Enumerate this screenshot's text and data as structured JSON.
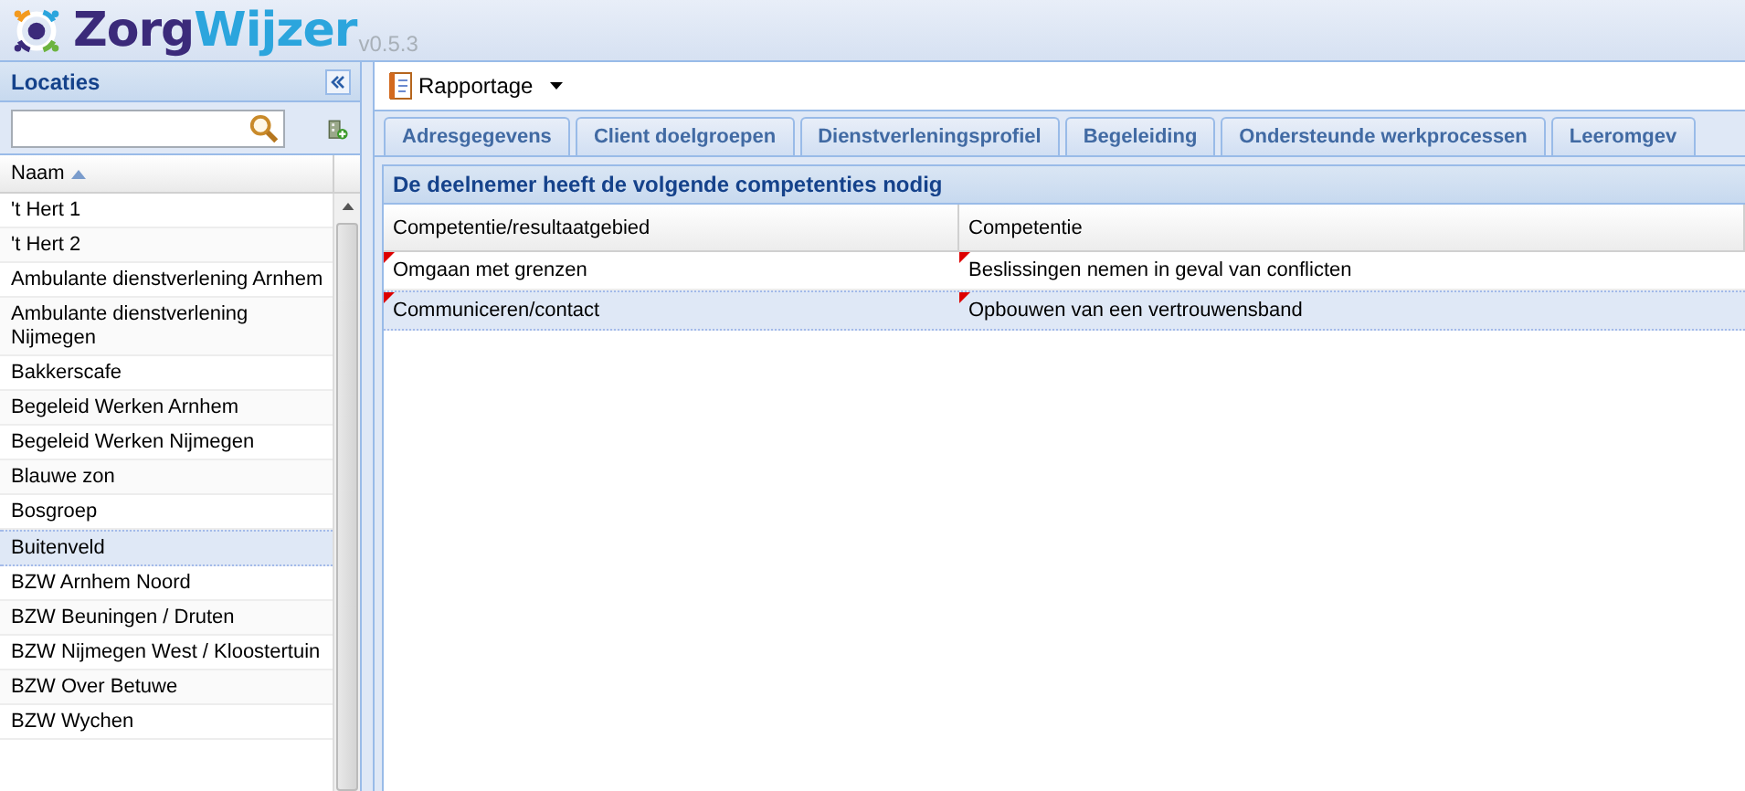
{
  "header": {
    "brand": [
      "Zorg",
      "Wijzer"
    ],
    "version": "v0.5.3"
  },
  "sidebar": {
    "title": "Locaties",
    "column": "Naam",
    "items": [
      {
        "label": "'t Hert 1",
        "selected": false
      },
      {
        "label": "'t Hert 2",
        "selected": false
      },
      {
        "label": "Ambulante dienstverlening Arnhem",
        "selected": false
      },
      {
        "label": "Ambulante dienstverlening Nijmegen",
        "selected": false
      },
      {
        "label": "Bakkerscafe",
        "selected": false
      },
      {
        "label": "Begeleid Werken Arnhem",
        "selected": false
      },
      {
        "label": "Begeleid Werken Nijmegen",
        "selected": false
      },
      {
        "label": "Blauwe zon",
        "selected": false
      },
      {
        "label": "Bosgroep",
        "selected": false
      },
      {
        "label": "Buitenveld",
        "selected": true
      },
      {
        "label": "BZW Arnhem Noord",
        "selected": false
      },
      {
        "label": "BZW Beuningen / Druten",
        "selected": false
      },
      {
        "label": "BZW Nijmegen West / Kloostertuin",
        "selected": false
      },
      {
        "label": "BZW Over Betuwe",
        "selected": false
      },
      {
        "label": "BZW Wychen",
        "selected": false
      }
    ]
  },
  "toolbar": {
    "menu": "Rapportage"
  },
  "tabs": [
    {
      "label": "Adresgegevens"
    },
    {
      "label": "Client doelgroepen"
    },
    {
      "label": "Dienstverleningsprofiel"
    },
    {
      "label": "Begeleiding"
    },
    {
      "label": "Ondersteunde werkprocessen"
    },
    {
      "label": "Leeromgev"
    }
  ],
  "panel": {
    "title": "De deelnemer heeft de volgende competenties nodig",
    "table": {
      "columns": [
        "Competentie/resultaatgebied",
        "Competentie"
      ],
      "rows": [
        {
          "selected": false,
          "cells": [
            {
              "text": "Omgaan met grenzen",
              "modified": true
            },
            {
              "text": "Beslissingen nemen in geval van conflicten",
              "modified": true
            }
          ]
        },
        {
          "selected": true,
          "cells": [
            {
              "text": "Communiceren/contact",
              "modified": true
            },
            {
              "text": "Opbouwen van een vertrouwensband",
              "modified": true
            }
          ]
        }
      ]
    }
  }
}
